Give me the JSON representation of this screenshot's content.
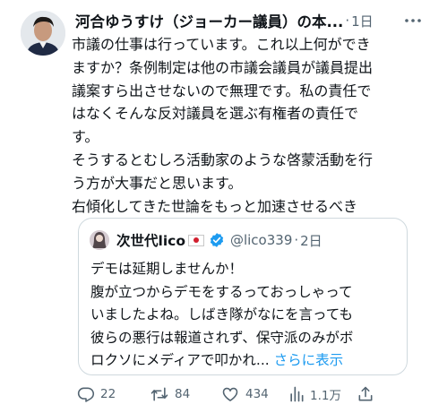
{
  "author": {
    "name": "河合ゆうすけ（ジョーカー議員）の本...",
    "time": "1日"
  },
  "tweet_lines": [
    "市議の仕事は行っています。これ以上何ができ",
    "ますか？条例制定は他の市議会議員が議員提出",
    "議案すら出させないので無理です。私の責任で",
    "はなくそんな反対議員を選ぶ有権者の責任で",
    "す。",
    "そうするとむしろ活動家のような啓蒙活動を行",
    "う方が大事だと思います。",
    "右傾化してきた世論をもっと加速させるべき"
  ],
  "quote": {
    "name": "次世代lico",
    "handle": "@lico339",
    "time": "2日",
    "lines": [
      "デモは延期しませんか！",
      "腹が立つからデモをするっておっしゃって",
      "いましたよね。しばき隊がなにを言っても",
      "彼らの悪行は報道されず、保守派のみがボ",
      "ロクソにメディアで叩かれ..."
    ],
    "show_more": "さらに表示"
  },
  "actions": {
    "replies": "22",
    "reposts": "84",
    "likes": "434",
    "views": "1.1万"
  },
  "colors": {
    "text": "#0f1419",
    "secondary": "#536471",
    "link": "#1d9bf0",
    "border": "#cfd9de",
    "verified": "#1d9bf0"
  },
  "icons": [
    "more-icon",
    "flag-icon",
    "verified-icon",
    "reply-icon",
    "repost-icon",
    "like-icon",
    "views-icon",
    "share-icon"
  ]
}
